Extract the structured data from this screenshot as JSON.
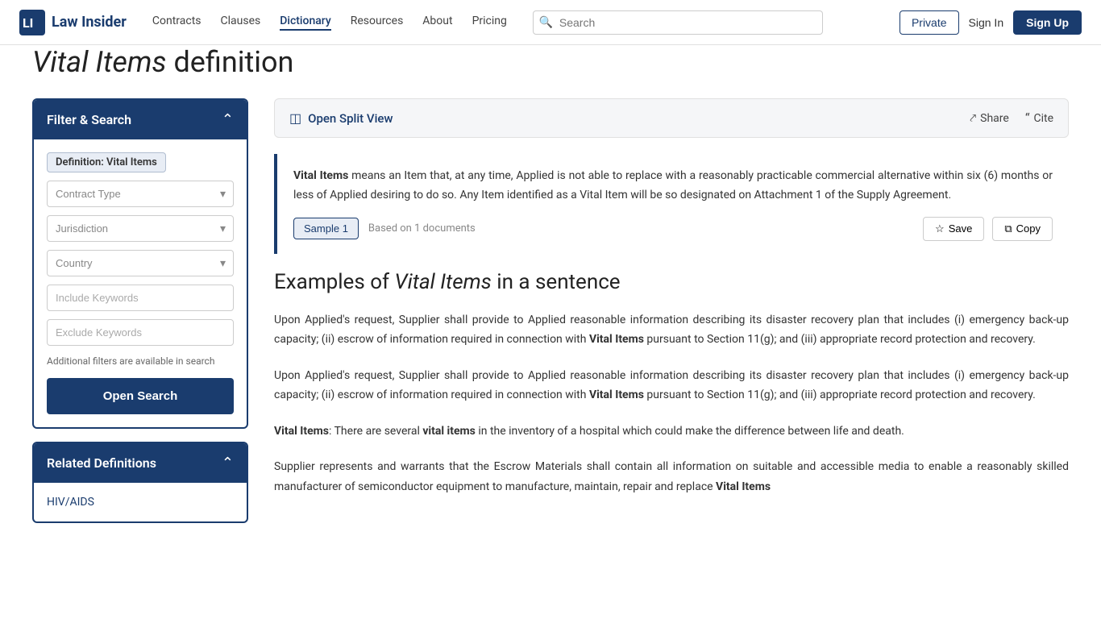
{
  "nav": {
    "logo_text": "Law Insider",
    "links": [
      {
        "label": "Contracts",
        "active": false
      },
      {
        "label": "Clauses",
        "active": false
      },
      {
        "label": "Dictionary",
        "active": true
      },
      {
        "label": "Resources",
        "active": false
      },
      {
        "label": "About",
        "active": false
      },
      {
        "label": "Pricing",
        "active": false
      }
    ],
    "search_placeholder": "Search",
    "btn_private": "Private",
    "btn_signin": "Sign In",
    "btn_signup": "Sign Up"
  },
  "page": {
    "title_part1": "Vital Items",
    "title_part2": " definition"
  },
  "filter": {
    "header_title": "Filter & Search",
    "definition_tag_prefix": "Definition: ",
    "definition_tag_value": "Vital Items",
    "contract_type_placeholder": "Contract Type",
    "jurisdiction_placeholder": "Jurisdiction",
    "country_placeholder": "Country",
    "include_keywords_placeholder": "Include Keywords",
    "exclude_keywords_placeholder": "Exclude Keywords",
    "additional_filters_note": "Additional filters are available in search",
    "open_search_btn": "Open Search"
  },
  "related": {
    "header_title": "Related Definitions",
    "items": [
      {
        "label": "HIV/AIDS"
      }
    ]
  },
  "content": {
    "open_split_view": "Open Split View",
    "share_label": "Share",
    "cite_label": "Cite",
    "definition_text": "Vital Items means an Item that, at any time, Applied is not able to replace with a reasonably practicable commercial alternative within six (6) months or less of Applied desiring to do so. Any Item identified as a Vital Item will be so designated on Attachment 1 of the Supply Agreement.",
    "definition_bold": "Vital Items",
    "sample_btn": "Sample 1",
    "based_on": "Based on 1 documents",
    "save_btn": "Save",
    "copy_btn": "Copy",
    "examples_title_part1": "Examples of ",
    "examples_title_italic": "Vital Items",
    "examples_title_part2": " in a sentence",
    "examples": [
      {
        "text": "Upon Applied's request, Supplier shall provide to Applied reasonable information describing its disaster recovery plan that includes (i) emergency back-up capacity; (ii) escrow of information required in connection with Vital Items pursuant to Section 11(g); and (iii) appropriate record protection and recovery.",
        "bold": "Vital Items"
      },
      {
        "text": "Upon Applied's request, Supplier shall provide to Applied reasonable information describing its disaster recovery plan that includes (i) emergency back-up capacity; (ii) escrow of information required in connection with Vital Items pursuant to Section 11(g); and (iii) appropriate record protection and recovery.",
        "bold": "Vital Items"
      },
      {
        "text": "Vital Items: There are several vital items in the inventory of a hospital which could make the difference between life and death.",
        "bold_start": "Vital Items",
        "bold_inline": "vital items"
      },
      {
        "text": "Supplier represents and warrants that the Escrow Materials shall contain all information on suitable and accessible media to enable a reasonably skilled manufacturer of semiconductor equipment to manufacture, maintain, repair and replace Vital Items",
        "bold": "Vital Items"
      }
    ]
  }
}
